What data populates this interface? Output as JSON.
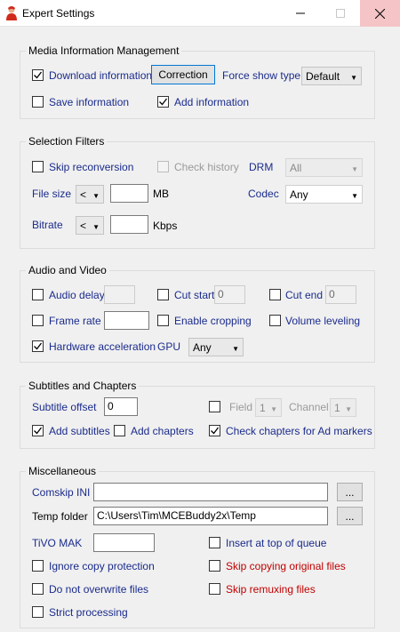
{
  "window": {
    "title": "Expert Settings",
    "controls": {
      "minimize": "—",
      "maximize": "☐",
      "close": "✕"
    }
  },
  "media": {
    "title": "Media Information Management",
    "download_label": "Download information",
    "correction_button": "Correction",
    "force_show_type_label": "Force show type",
    "force_show_type_value": "Default",
    "save_label": "Save information",
    "add_label": "Add information"
  },
  "filters": {
    "title": "Selection Filters",
    "skip_reconversion_label": "Skip reconversion",
    "check_history_label": "Check history",
    "drm_label": "DRM",
    "drm_value": "All",
    "file_size_label": "File size",
    "file_size_op": "<",
    "file_size_value": "",
    "file_size_unit": "MB",
    "codec_label": "Codec",
    "codec_value": "Any",
    "bitrate_label": "Bitrate",
    "bitrate_op": "<",
    "bitrate_value": "",
    "bitrate_unit": "Kbps"
  },
  "av": {
    "title": "Audio and Video",
    "audio_delay_label": "Audio delay",
    "audio_delay_value": "",
    "cut_start_label": "Cut start",
    "cut_start_value": "0",
    "cut_end_label": "Cut end",
    "cut_end_value": "0",
    "frame_rate_label": "Frame rate",
    "frame_rate_value": "",
    "enable_cropping_label": "Enable cropping",
    "volume_leveling_label": "Volume leveling",
    "hw_accel_label": "Hardware acceleration",
    "gpu_label": "GPU",
    "gpu_value": "Any"
  },
  "subs": {
    "title": "Subtitles and Chapters",
    "offset_label": "Subtitle offset",
    "offset_value": "0",
    "field_label": "Field",
    "field_value": "1",
    "channel_label": "Channel",
    "channel_value": "1",
    "add_subtitles_label": "Add subtitles",
    "add_chapters_label": "Add chapters",
    "check_chapters_label": "Check chapters for Ad markers"
  },
  "misc": {
    "title": "Miscellaneous",
    "comskip_label": "Comskip INI",
    "comskip_value": "",
    "browse_label": "...",
    "temp_label": "Temp folder",
    "temp_value": "C:\\Users\\Tim\\MCEBuddy2x\\Temp",
    "tivo_label": "TiVO MAK",
    "tivo_value": "",
    "insert_top_label": "Insert at top of queue",
    "ignore_copy_label": "Ignore copy protection",
    "skip_copying_label": "Skip copying original files",
    "no_overwrite_label": "Do not overwrite files",
    "skip_remux_label": "Skip remuxing files",
    "strict_label": "Strict processing"
  },
  "checkbox_states": {
    "download": true,
    "save": false,
    "add": true,
    "skip_reconversion": false,
    "check_history": false,
    "audio_delay": false,
    "cut_start": false,
    "cut_end": false,
    "frame_rate": false,
    "enable_cropping": false,
    "volume_leveling": false,
    "hw_accel": true,
    "field": false,
    "add_subtitles": true,
    "add_chapters": false,
    "check_chapters": true,
    "insert_top": false,
    "ignore_copy": false,
    "skip_copying": false,
    "no_overwrite": false,
    "skip_remux": false,
    "strict": false
  },
  "colors": {
    "label_blue": "#1a2b8c",
    "warning_red": "#c00000",
    "close_hover": "#f4c4c6"
  }
}
